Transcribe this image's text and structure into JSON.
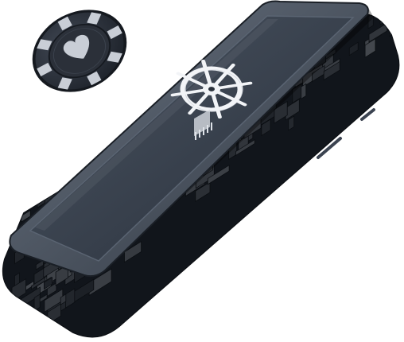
{
  "illustration": {
    "chip_icon": "poker-chip-heart-icon",
    "helm_icon": "ship-wheel-icon",
    "device": "opened-smartphone-hardware-illustration"
  },
  "colors": {
    "background": "#ffffff",
    "chip_body": "#2b3039",
    "chip_stripe": "#c9ced6",
    "chip_heart": "#c9ced6",
    "phone_frame": "#1b2028",
    "screen_panel": "#3a4350",
    "screen_border": "#5a6472",
    "wheel": "#f2f4f7",
    "internals": "#151a21",
    "component": "#2a313b"
  }
}
